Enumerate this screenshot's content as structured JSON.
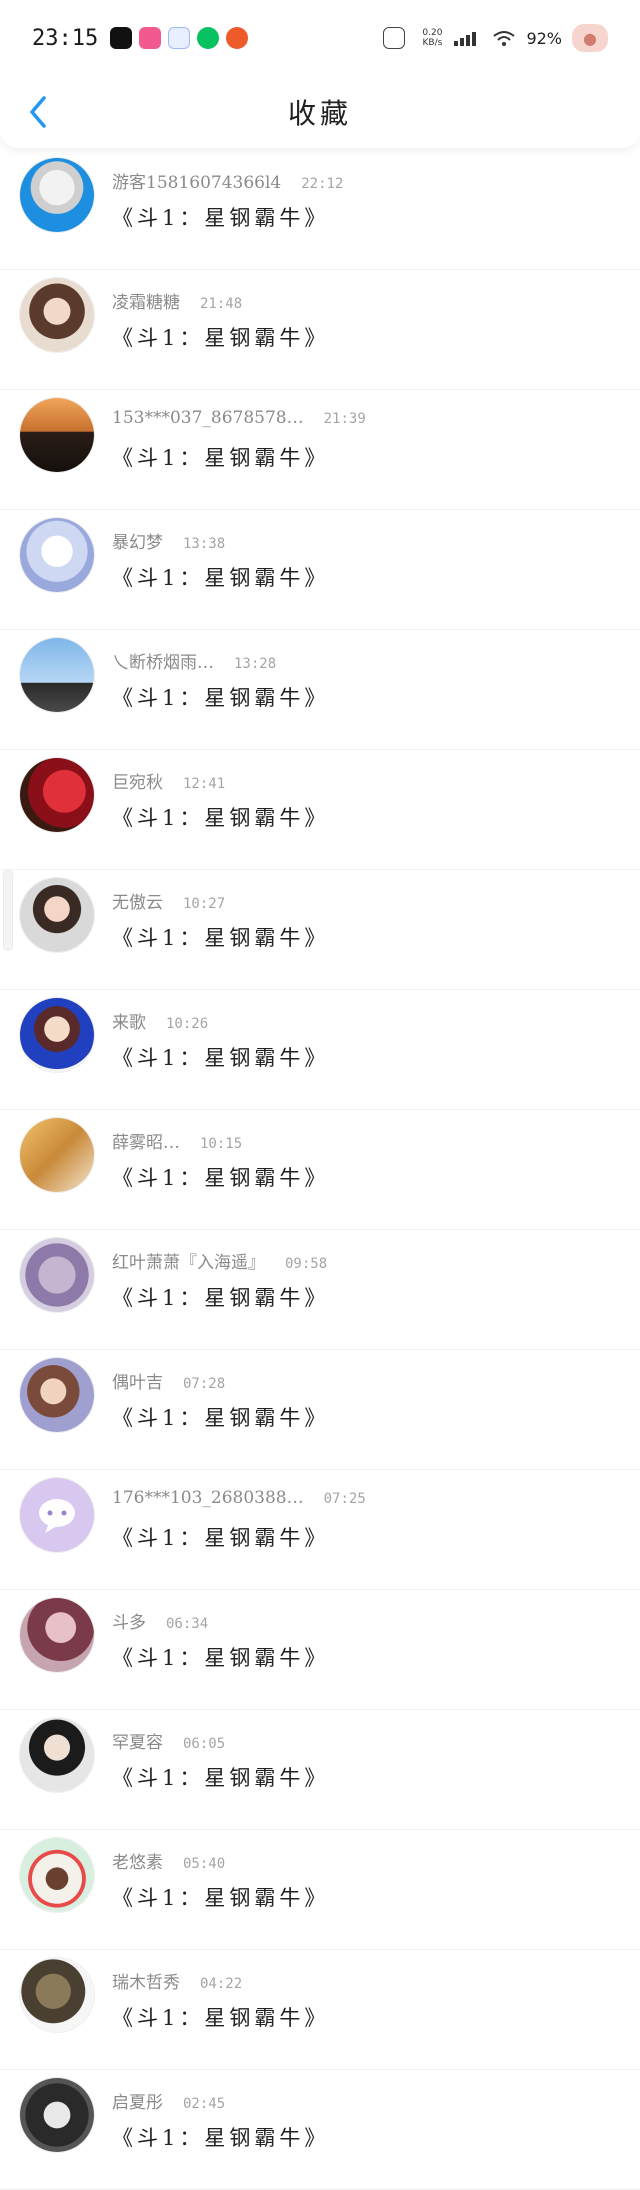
{
  "status_bar": {
    "time": "23:15",
    "net_speed_value": "0.20",
    "net_speed_unit": "KB/s",
    "battery": "92%"
  },
  "header": {
    "title": "收藏"
  },
  "colors": {
    "accent": "#2196f3"
  },
  "items": [
    {
      "name": "游客15816074366l4",
      "time": "22:12",
      "book": "《斗1：星钢霸牛》"
    },
    {
      "name": "凌霜糖糖",
      "time": "21:48",
      "book": "《斗1：星钢霸牛》"
    },
    {
      "name": "153***037_8678578…",
      "time": "21:39",
      "book": "《斗1：星钢霸牛》"
    },
    {
      "name": "暴幻梦",
      "time": "13:38",
      "book": "《斗1：星钢霸牛》"
    },
    {
      "name": "乀断桥烟雨…",
      "time": "13:28",
      "book": "《斗1：星钢霸牛》"
    },
    {
      "name": "巨宛秋",
      "time": "12:41",
      "book": "《斗1：星钢霸牛》"
    },
    {
      "name": "无傲云",
      "time": "10:27",
      "book": "《斗1：星钢霸牛》"
    },
    {
      "name": "来歌",
      "time": "10:26",
      "book": "《斗1：星钢霸牛》"
    },
    {
      "name": "薛雾昭…",
      "time": "10:15",
      "book": "《斗1：星钢霸牛》"
    },
    {
      "name": "红叶萧萧『入海遥』",
      "time": "09:58",
      "book": "《斗1：星钢霸牛》"
    },
    {
      "name": "偶叶吉",
      "time": "07:28",
      "book": "《斗1：星钢霸牛》"
    },
    {
      "name": "176***103_2680388…",
      "time": "07:25",
      "book": "《斗1：星钢霸牛》"
    },
    {
      "name": "斗多",
      "time": "06:34",
      "book": "《斗1：星钢霸牛》"
    },
    {
      "name": "罕夏容",
      "time": "06:05",
      "book": "《斗1：星钢霸牛》"
    },
    {
      "name": "老悠素",
      "time": "05:40",
      "book": "《斗1：星钢霸牛》"
    },
    {
      "name": "瑞木哲秀",
      "time": "04:22",
      "book": "《斗1：星钢霸牛》"
    },
    {
      "name": "启夏彤",
      "time": "02:45",
      "book": "《斗1：星钢霸牛》"
    }
  ]
}
